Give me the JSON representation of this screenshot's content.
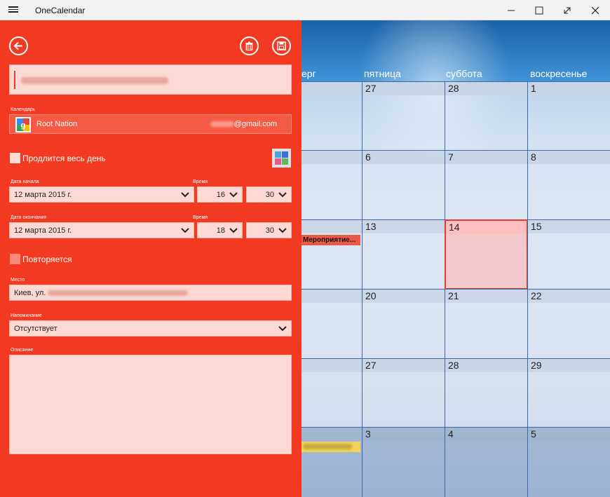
{
  "window": {
    "title": "OneCalendar"
  },
  "calendar": {
    "day_names": [
      "ерг",
      "пятница",
      "суббота",
      "воскресенье"
    ],
    "rows": [
      [
        "",
        "27",
        "28",
        "1"
      ],
      [
        "",
        "6",
        "7",
        "8"
      ],
      [
        "",
        "13",
        "14",
        "15"
      ],
      [
        "",
        "20",
        "21",
        "22"
      ],
      [
        "",
        "27",
        "28",
        "29"
      ],
      [
        "",
        "3",
        "4",
        "5"
      ]
    ],
    "event_red": "Мероприятие...",
    "colors": {
      "today_border": "#e53935",
      "event_red": "#e85a47",
      "event_yellow": "#f2d25b"
    }
  },
  "form": {
    "calendar_label": "Календарь",
    "calendar_name": "Root Nation",
    "calendar_email": "@gmail.com",
    "all_day_label": "Продлится весь день",
    "start_date_label": "Дата начала",
    "start_time_label": "Время",
    "start_date": "12 марта 2015 г.",
    "start_hour": "16",
    "start_min": "30",
    "end_date_label": "Дата окончания",
    "end_time_label": "Время",
    "end_date": "12 марта 2015 г.",
    "end_hour": "18",
    "end_min": "30",
    "repeat_label": "Повторяется",
    "place_label": "Место",
    "place_value": "Киев, ул.",
    "reminder_label": "Напоминание",
    "reminder_value": "Отсутствует",
    "description_label": "Описание",
    "panel_color": "#f23a22"
  }
}
